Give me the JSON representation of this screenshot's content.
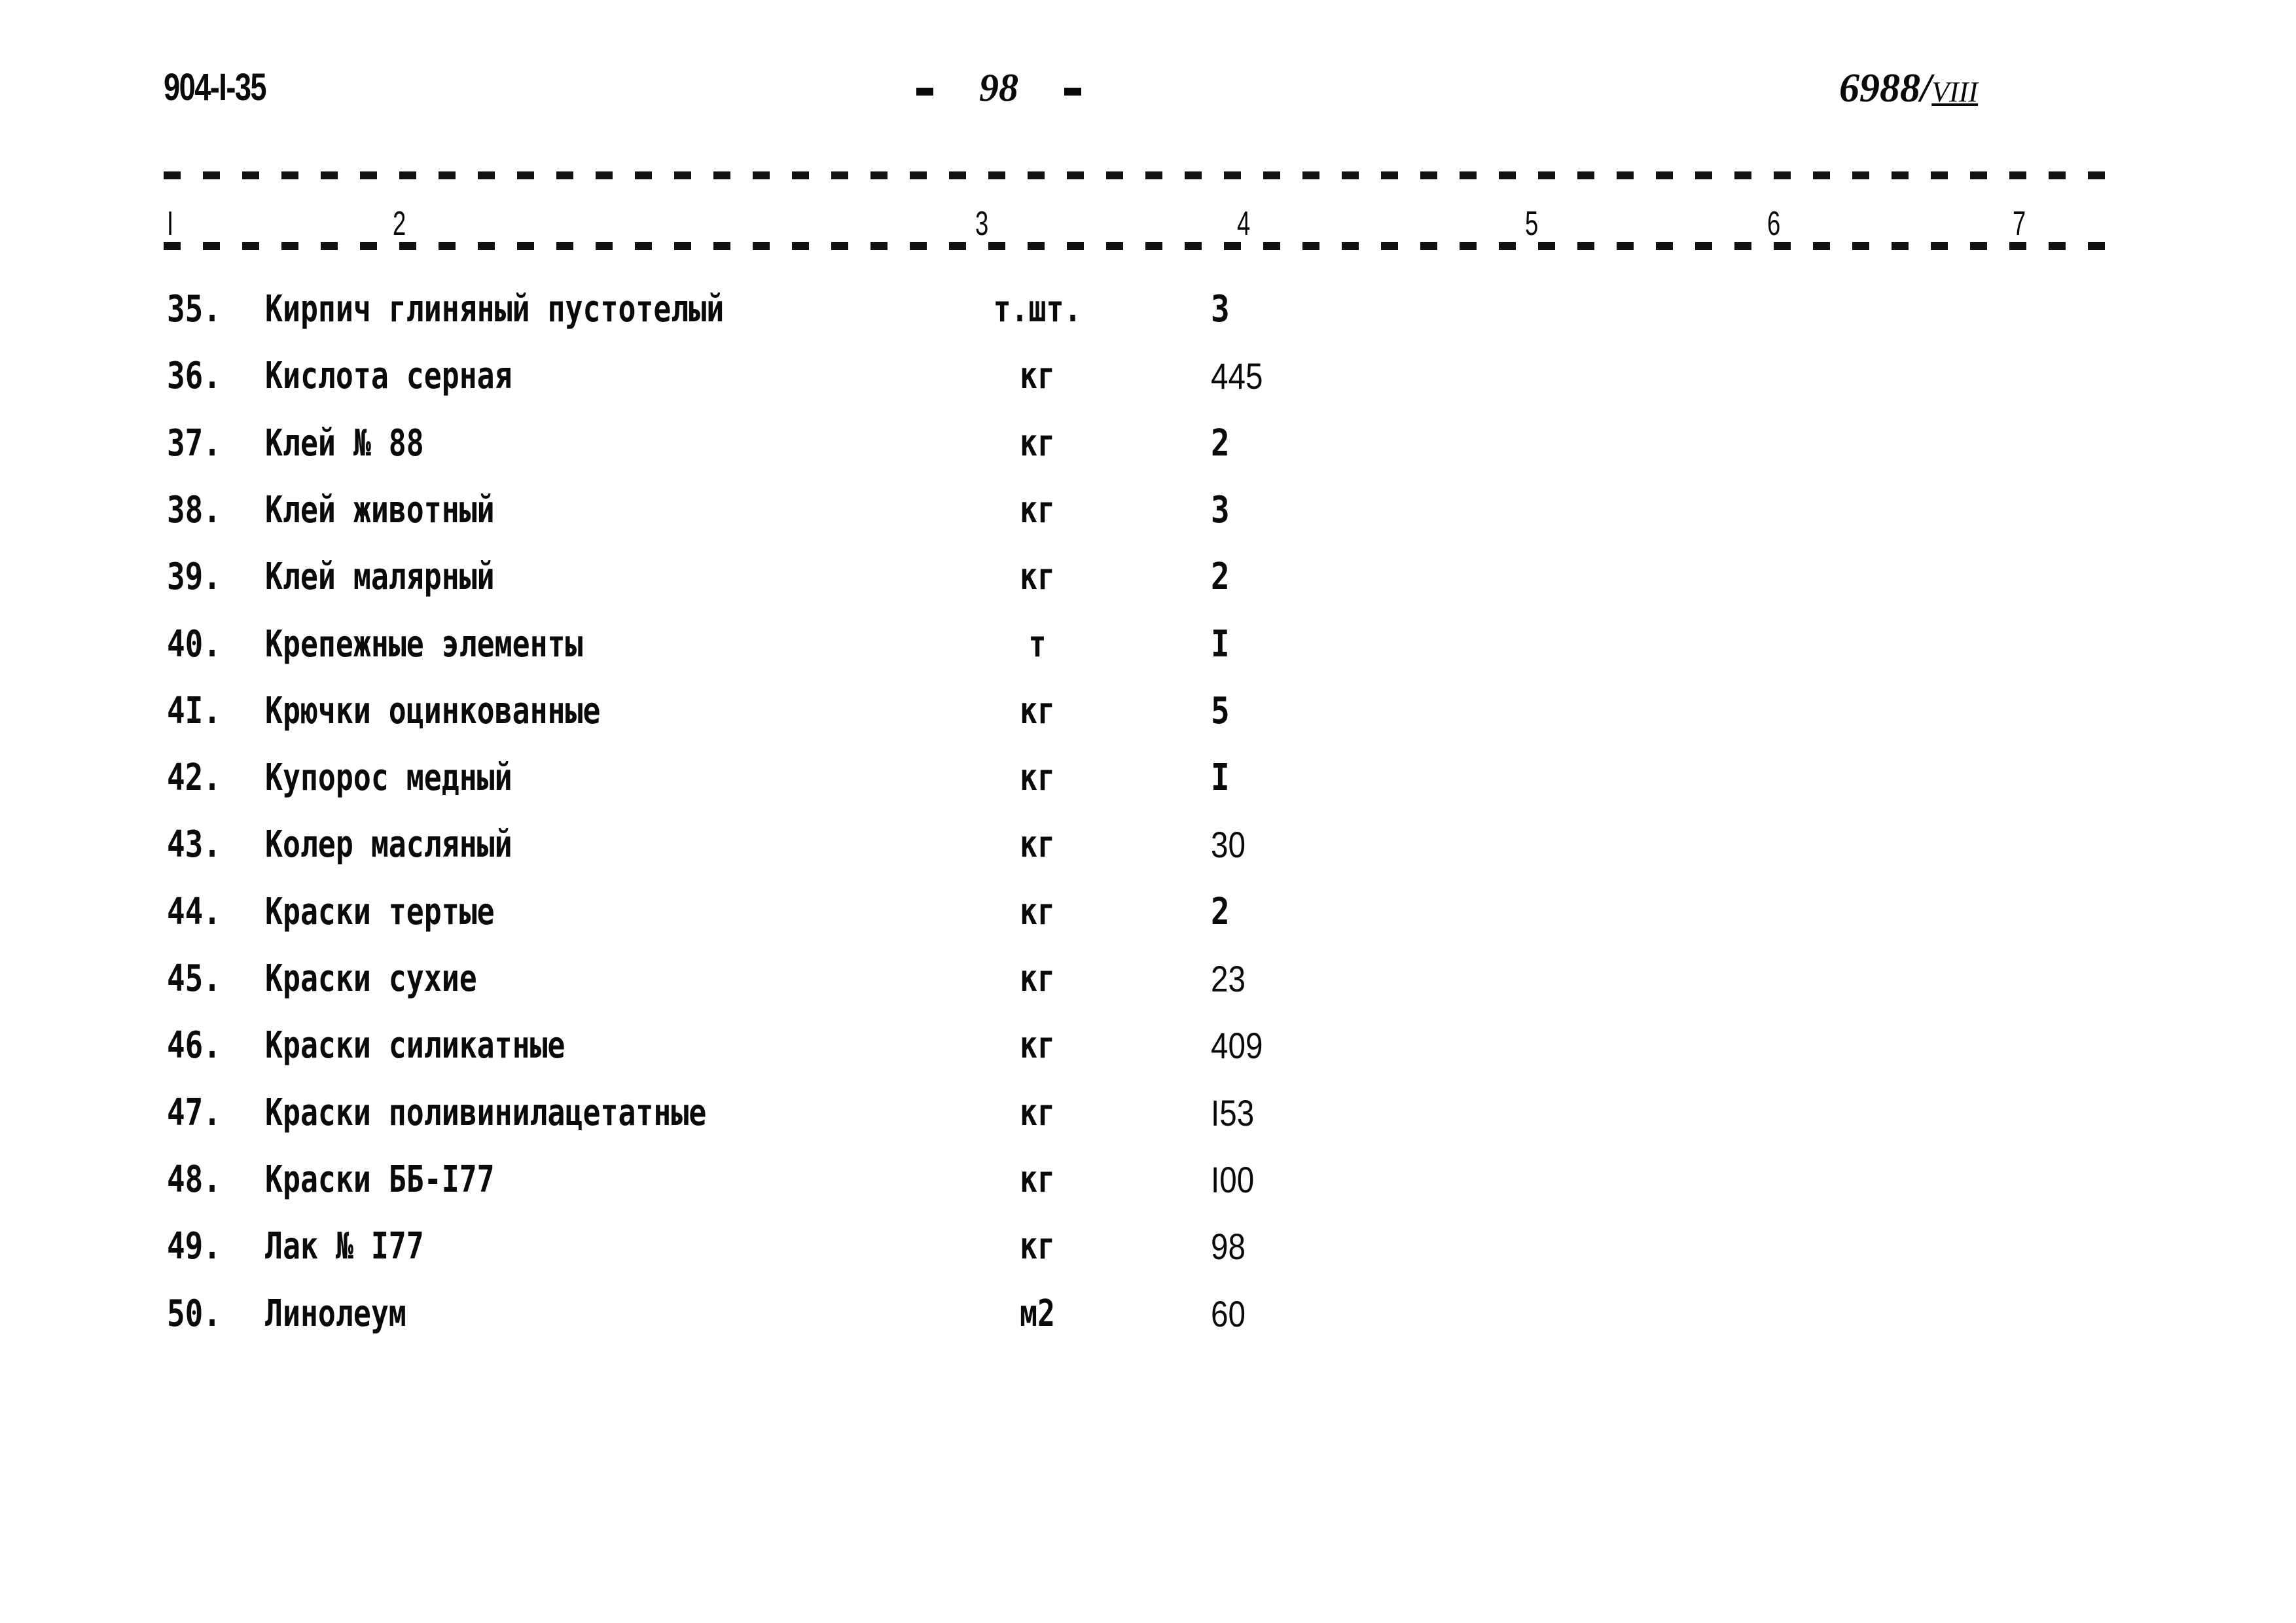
{
  "header": {
    "document_code": "904-I-35",
    "page_number": "98",
    "reference": "6988/",
    "reference_suffix": "VIII"
  },
  "table": {
    "column_numbers": [
      "I",
      "2",
      "3",
      "4",
      "5",
      "6",
      "7"
    ],
    "rows": [
      {
        "num": "35.",
        "name": "Кирпич глиняный пустотелый",
        "unit": "т.шт.",
        "qty": "3"
      },
      {
        "num": "36.",
        "name": "Кислота серная",
        "unit": "кг",
        "qty": "445"
      },
      {
        "num": "37.",
        "name": "Клей № 88",
        "unit": "кг",
        "qty": "2"
      },
      {
        "num": "38.",
        "name": "Клей животный",
        "unit": "кг",
        "qty": "3"
      },
      {
        "num": "39.",
        "name": "Клей малярный",
        "unit": "кг",
        "qty": "2"
      },
      {
        "num": "40.",
        "name": "Крепежные элементы",
        "unit": "т",
        "qty": "I"
      },
      {
        "num": "4I.",
        "name": "Крючки оцинкованные",
        "unit": "кг",
        "qty": "5"
      },
      {
        "num": "42.",
        "name": "Купорос медный",
        "unit": "кг",
        "qty": "I"
      },
      {
        "num": "43.",
        "name": "Колер масляный",
        "unit": "кг",
        "qty": "30"
      },
      {
        "num": "44.",
        "name": "Краски тертые",
        "unit": "кг",
        "qty": "2"
      },
      {
        "num": "45.",
        "name": "Краски сухие",
        "unit": "кг",
        "qty": "23"
      },
      {
        "num": "46.",
        "name": "Краски силикатные",
        "unit": "кг",
        "qty": "409"
      },
      {
        "num": "47.",
        "name": "Краски поливинилацетатные",
        "unit": "кг",
        "qty": "I53"
      },
      {
        "num": "48.",
        "name": "Краски ББ-I77",
        "unit": "кг",
        "qty": "I00"
      },
      {
        "num": "49.",
        "name": "Лак № I77",
        "unit": "кг",
        "qty": "98"
      },
      {
        "num": "50.",
        "name": "Линолеум",
        "unit": "м2",
        "qty": "60"
      }
    ]
  }
}
